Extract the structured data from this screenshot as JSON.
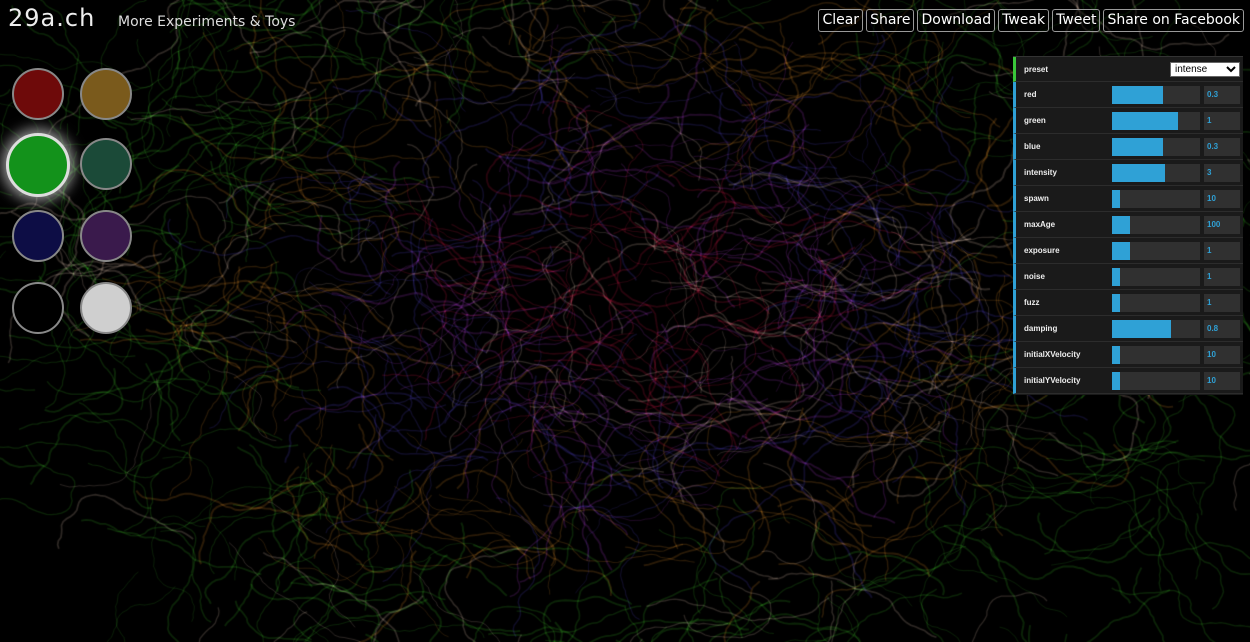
{
  "header": {
    "logo": "29a.ch",
    "more_link": "More Experiments & Toys"
  },
  "toolbar": [
    "Clear",
    "Share",
    "Download",
    "Tweak",
    "Tweet",
    "Share on Facebook"
  ],
  "swatches": [
    {
      "name": "dark-red",
      "color": "#6e0a0a"
    },
    {
      "name": "olive-gold",
      "color": "#7a5a1c"
    },
    {
      "name": "green",
      "color": "#13921b",
      "selected": true
    },
    {
      "name": "dark-teal",
      "color": "#1b4a38"
    },
    {
      "name": "navy",
      "color": "#0d0d45"
    },
    {
      "name": "dark-purple",
      "color": "#3a1a4c"
    },
    {
      "name": "black",
      "color": "#000000"
    },
    {
      "name": "light-gray",
      "color": "#cfcfcf"
    }
  ],
  "controls": {
    "preset": {
      "label": "preset",
      "value": "intense"
    },
    "params": [
      {
        "label": "red",
        "value": "0.3",
        "fill": 0.58
      },
      {
        "label": "green",
        "value": "1",
        "fill": 0.75
      },
      {
        "label": "blue",
        "value": "0.3",
        "fill": 0.58
      },
      {
        "label": "intensity",
        "value": "3",
        "fill": 0.6
      },
      {
        "label": "spawn",
        "value": "10",
        "fill": 0.09
      },
      {
        "label": "maxAge",
        "value": "100",
        "fill": 0.2
      },
      {
        "label": "exposure",
        "value": "1",
        "fill": 0.2
      },
      {
        "label": "noise",
        "value": "1",
        "fill": 0.09
      },
      {
        "label": "fuzz",
        "value": "1",
        "fill": 0.09
      },
      {
        "label": "damping",
        "value": "0.8",
        "fill": 0.67
      },
      {
        "label": "initialXVelocity",
        "value": "10",
        "fill": 0.09
      },
      {
        "label": "initialYVelocity",
        "value": "10",
        "fill": 0.09
      }
    ]
  },
  "colors": {
    "accent": "#2fa1d6",
    "panel_bg": "#1a1a1a"
  }
}
